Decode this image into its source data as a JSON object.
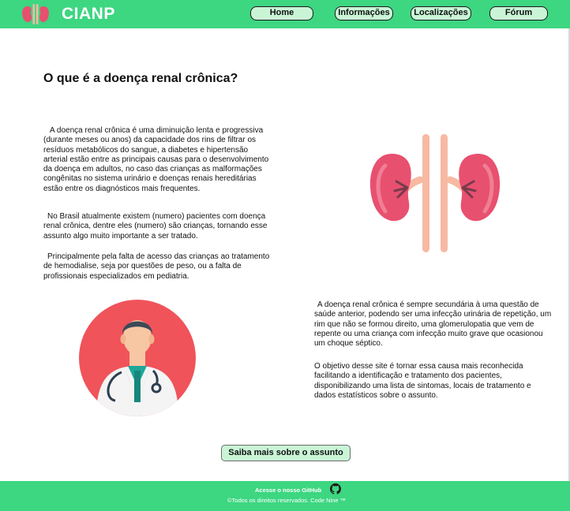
{
  "header": {
    "brand": "CIANP",
    "logo_icon": "kidneys-icon",
    "nav": [
      "Home",
      "Informações",
      "Localizações",
      "Fórum"
    ]
  },
  "main": {
    "title": "O que é a doença renal crônica?",
    "paragraphs": [
      "A doença renal crônica é uma diminuição lenta e progressiva (durante meses ou anos) da capacidade dos rins de filtrar os resíduos metabólicos do sangue, a diabetes e hipertensão arterial estão entre as principais causas para o desenvolvimento da doença em adultos, no caso das crianças as malformações congênitas no sistema urinário e doenças renais hereditárias estão entre os diagnósticos mais frequentes.",
      "No Brasil atualmente existem  (numero) pacientes com doença renal crônica, dentre eles (numero) são crianças, tornando esse assunto algo muito importante a ser tratado.",
      "Principalmente pela falta de acesso das crianças ao tratamento de hemodialise, seja por questões de peso, ou a falta de profissionais especializados em pediatria.",
      "A doença renal crônica é sempre secundária à uma questão de saúde anterior, podendo ser uma infecção urinária de repetição, um rim que não se formou direito, uma glomerulopatia que vem de repente ou uma criança com infecção muito grave que ocasionou um choque séptico.",
      "O objetivo desse site é tornar essa causa mais reconhecida facilitando a identificação e tratamento dos pacientes, disponibilizando uma lista de sintomas, locais de tratamento e dados estatísticos sobre o assunto."
    ],
    "illustrations": [
      "kidneys-illustration",
      "doctor-illustration"
    ],
    "cta": "Saiba mais sobre o assunto"
  },
  "footer": {
    "github_text": "Acesse o nosso GitHub",
    "github_icon": "github-icon",
    "copyright": "©Todos os direitos reservados. Code Nine ™"
  },
  "colors": {
    "brand_green": "#3dd681",
    "button_green": "#c9f5d6",
    "kidney_pink": "#e8506f",
    "doctor_circle": "#f0535a"
  }
}
